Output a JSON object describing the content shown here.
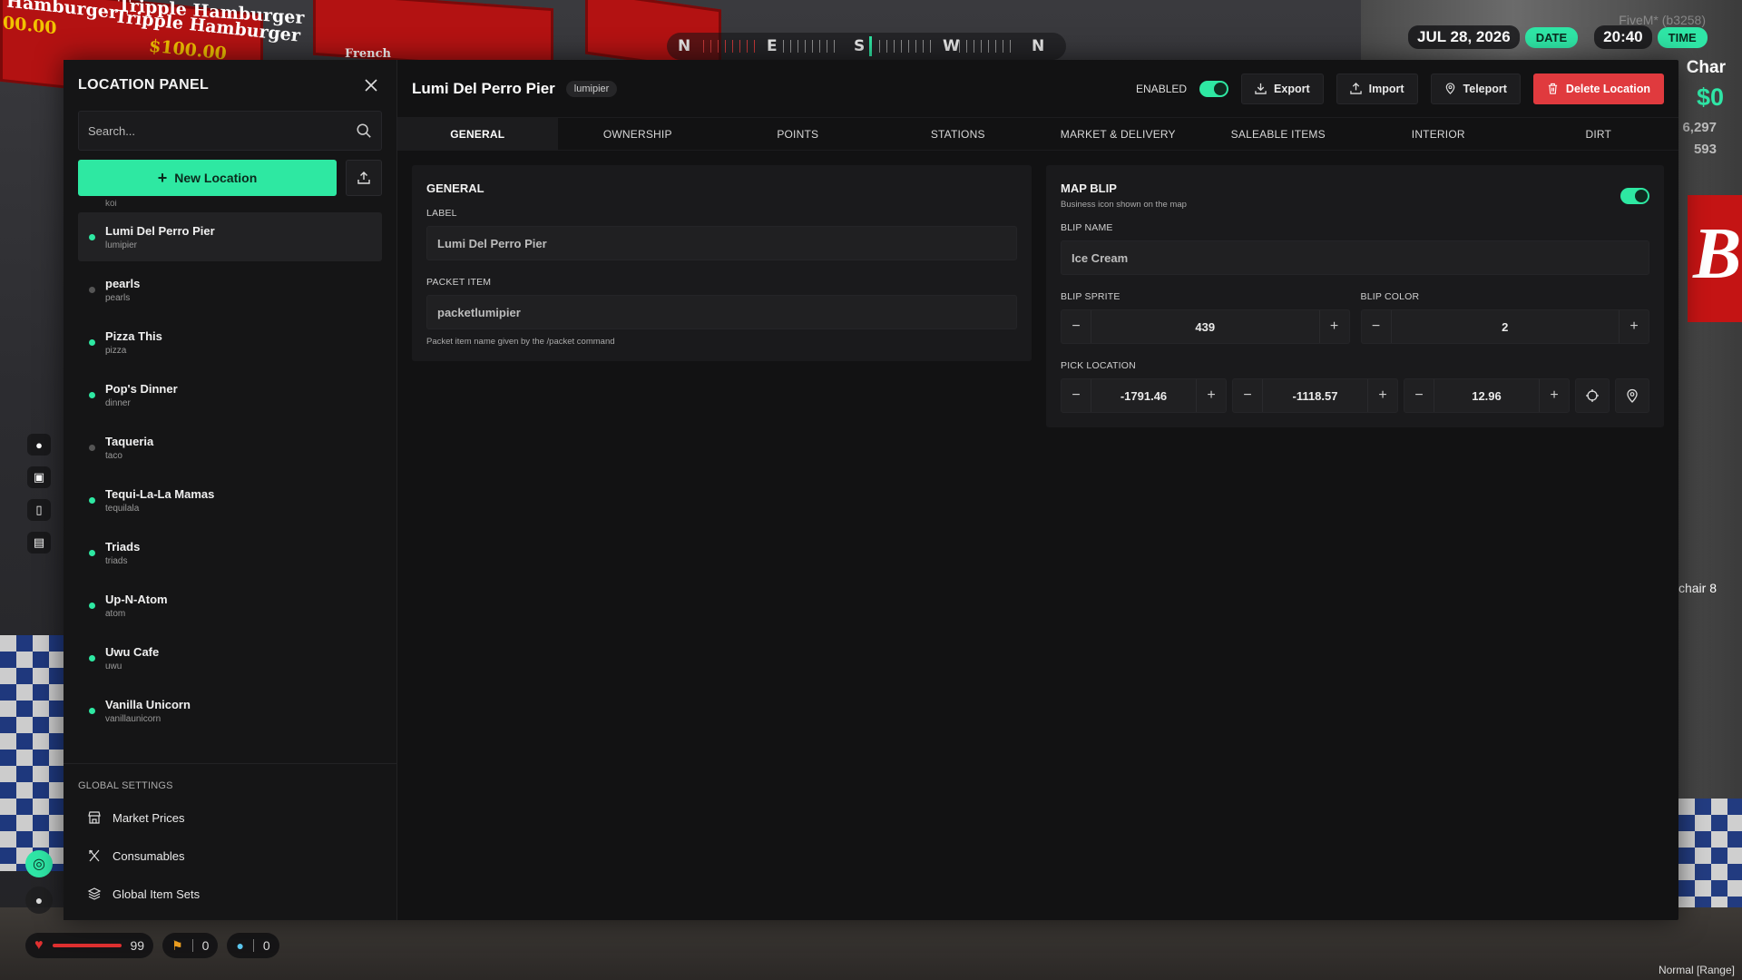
{
  "hud": {
    "sign_1_title": "Hamburger",
    "sign_1_price": "00.00",
    "sign_2_title": "Tripple Hamburger",
    "sign_2_price": "$100.00",
    "sign_3_title": "French",
    "compass": [
      "N",
      "E",
      "S",
      "W",
      "N"
    ],
    "date_value": "JUL 28, 2026",
    "date_tag": "DATE",
    "time_value": "20:40",
    "time_tag": "TIME",
    "server": "FiveM* (b3258)",
    "char_name": "Char",
    "cash": "$0",
    "stat_1": "6,297",
    "stat_2": "593",
    "chair_label": "l chair 8",
    "mode_label": "Normal [Range]",
    "health": "99",
    "hunger": "0",
    "thirst": "0"
  },
  "sidebar": {
    "title": "LOCATION PANEL",
    "search_placeholder": "Search...",
    "new_location_label": "New Location",
    "peek_item": "koi",
    "locations": [
      {
        "name": "Lumi Del Perro Pier",
        "id": "lumipier",
        "enabled": true,
        "active": true
      },
      {
        "name": "pearls",
        "id": "pearls",
        "enabled": false,
        "active": false
      },
      {
        "name": "Pizza This",
        "id": "pizza",
        "enabled": true,
        "active": false
      },
      {
        "name": "Pop's Dinner",
        "id": "dinner",
        "enabled": true,
        "active": false
      },
      {
        "name": "Taqueria",
        "id": "taco",
        "enabled": false,
        "active": false
      },
      {
        "name": "Tequi-La-La Mamas",
        "id": "tequilala",
        "enabled": true,
        "active": false
      },
      {
        "name": "Triads",
        "id": "triads",
        "enabled": true,
        "active": false
      },
      {
        "name": "Up-N-Atom",
        "id": "atom",
        "enabled": true,
        "active": false
      },
      {
        "name": "Uwu Cafe",
        "id": "uwu",
        "enabled": true,
        "active": false
      },
      {
        "name": "Vanilla Unicorn",
        "id": "vanillaunicorn",
        "enabled": true,
        "active": false
      }
    ],
    "global_settings_title": "GLOBAL SETTINGS",
    "global_settings": [
      {
        "label": "Market Prices",
        "icon": "store-icon"
      },
      {
        "label": "Consumables",
        "icon": "utensils-icon"
      },
      {
        "label": "Global Item Sets",
        "icon": "layers-icon"
      }
    ]
  },
  "header": {
    "title": "Lumi Del Perro Pier",
    "badge": "lumipier",
    "enabled_label": "ENABLED",
    "export_label": "Export",
    "import_label": "Import",
    "teleport_label": "Teleport",
    "delete_label": "Delete Location"
  },
  "tabs": [
    "GENERAL",
    "OWNERSHIP",
    "POINTS",
    "STATIONS",
    "MARKET & DELIVERY",
    "SALEABLE ITEMS",
    "INTERIOR",
    "DIRT"
  ],
  "general": {
    "title": "GENERAL",
    "label_label": "LABEL",
    "label_value": "Lumi Del Perro Pier",
    "packet_label": "PACKET ITEM",
    "packet_value": "packetlumipier",
    "packet_hint": "Packet item name given by the /packet command"
  },
  "blip": {
    "title": "MAP BLIP",
    "subtitle": "Business icon shown on the map",
    "name_label": "BLIP NAME",
    "name_value": "Ice Cream",
    "sprite_label": "BLIP SPRITE",
    "sprite_value": "439",
    "color_label": "BLIP COLOR",
    "color_value": "2",
    "pick_label": "PICK LOCATION",
    "x": "-1791.46",
    "y": "-1118.57",
    "z": "12.96"
  },
  "colors": {
    "accent": "#2ee8a2",
    "danger": "#e03a3e",
    "panel_bg": "#121213"
  }
}
